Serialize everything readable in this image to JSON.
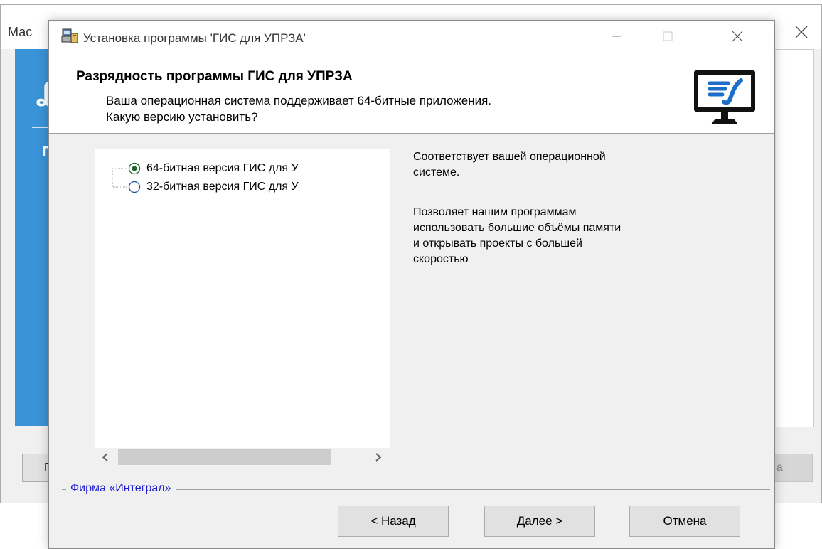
{
  "background_window": {
    "title": "Мас",
    "banner_text": "ПР",
    "left_button": "Г",
    "right_button": "а"
  },
  "dialog": {
    "title": "Установка программы 'ГИС для УПРЗА'",
    "header": {
      "title": "Разрядность программы ГИС для УПРЗА",
      "subtitle_line1": "Ваша операционная система поддерживает 64-битные приложения.",
      "subtitle_line2": "Какую версию установить?"
    },
    "options": [
      {
        "label": "64-битная версия ГИС для У",
        "selected": true
      },
      {
        "label": "32-битная версия ГИС для У",
        "selected": false
      }
    ],
    "description": {
      "line1": "Соответствует вашей операционной",
      "line2": "системе.",
      "line3": "Позволяет нашим программам",
      "line4": "использовать большие объёмы памяти",
      "line5": "и открывать проекты с большей",
      "line6": "скоростью"
    },
    "footer_group_label": "Фирма «Интеграл»",
    "buttons": {
      "back": "< Назад",
      "next": "Далее >",
      "cancel": "Отмена"
    }
  },
  "colors": {
    "accent_blue": "#3a93d6",
    "link_blue": "#1c1cd0",
    "logo_blue": "#1b6fc9"
  }
}
